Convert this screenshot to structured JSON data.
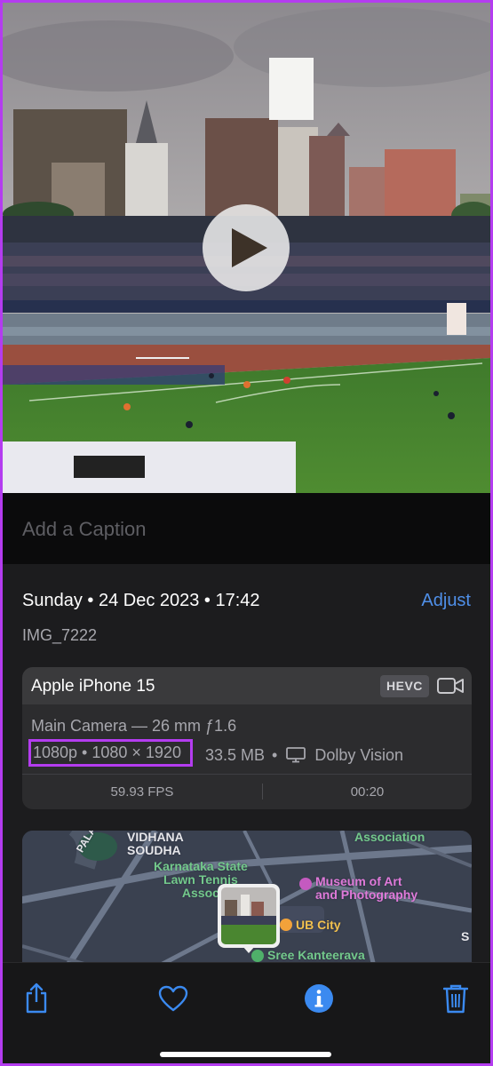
{
  "caption": {
    "placeholder": "Add a Caption"
  },
  "info": {
    "date": "Sunday • 24 Dec 2023 • 17:42",
    "adjust_label": "Adjust",
    "filename": "IMG_7222"
  },
  "device_card": {
    "device": "Apple iPhone 15",
    "format_badge": "HEVC",
    "camera": "Main Camera — 26 mm ƒ1.6",
    "resolution": "1080p • 1080 × 1920",
    "file_size": "33.5 MB",
    "separator": "•",
    "hdr": "Dolby Vision",
    "fps": "59.93 FPS",
    "duration": "00:20"
  },
  "map": {
    "labels": {
      "vidhana": "VIDHANA\nSOUDHA",
      "association": "Association",
      "karnataka": "Karnataka State\nLawn Tennis\nAssoc",
      "museum": "Museum of Art\nand Photography",
      "ubcity": "UB City",
      "kanteerava": "Sree Kanteerava",
      "palace": "PALACE",
      "edge_s": "S"
    }
  },
  "toolbar": {
    "share": "share-icon",
    "favorite": "heart-icon",
    "info": "info-icon",
    "delete": "trash-icon"
  },
  "colors": {
    "accent": "#4f8fe8",
    "highlight": "#b43cf0",
    "background": "#1c1c1e"
  }
}
